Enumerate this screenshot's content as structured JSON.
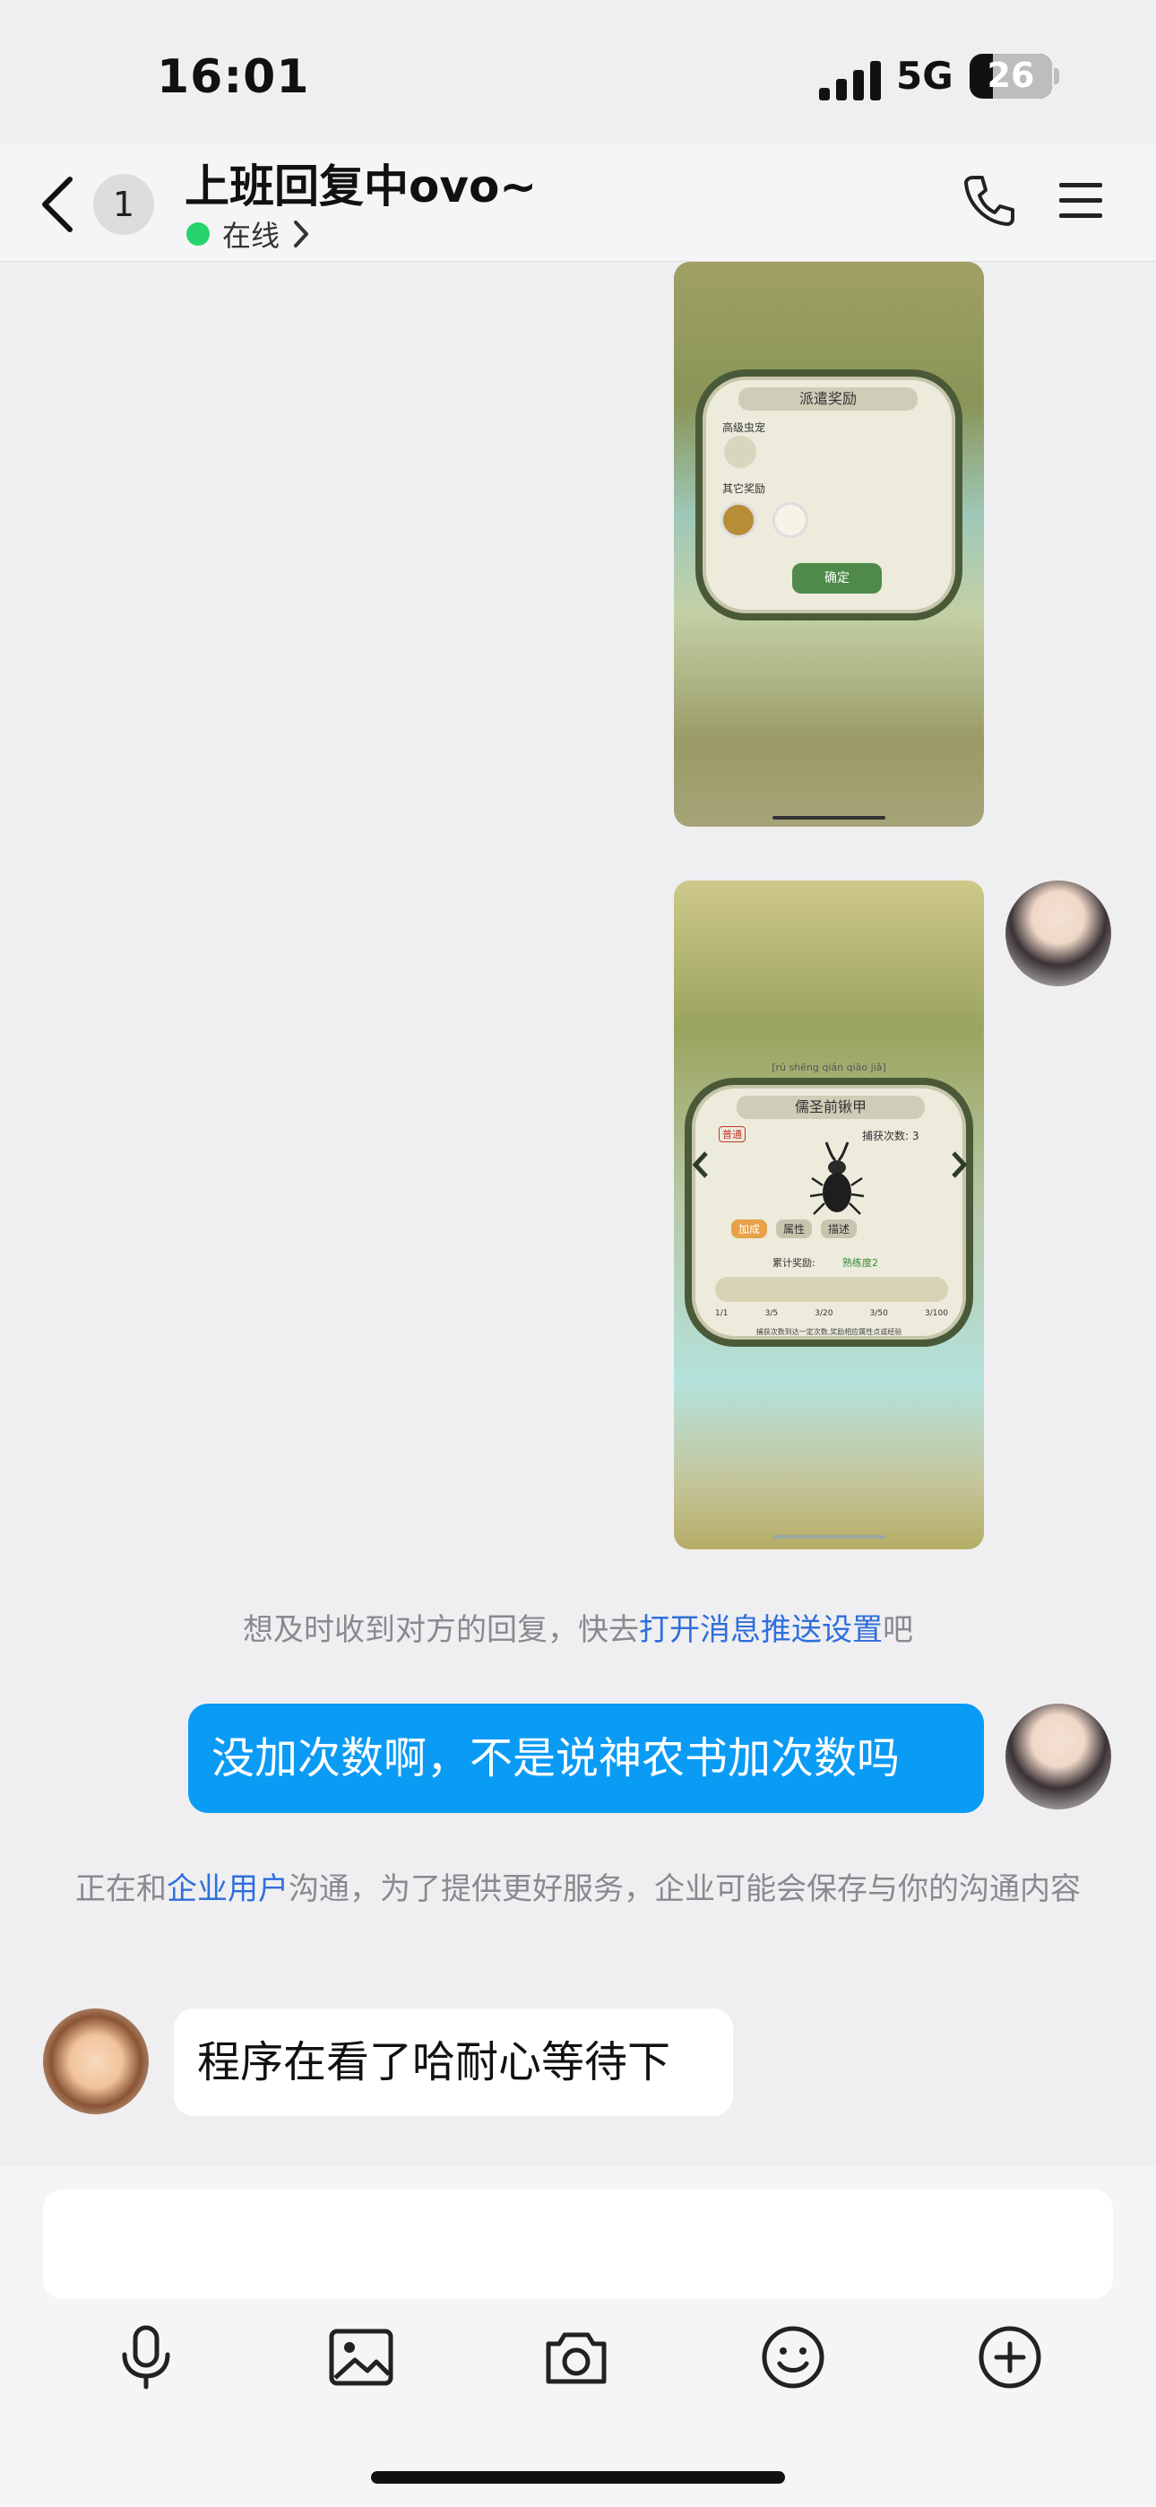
{
  "status_bar": {
    "time": "16:01",
    "network": "5G",
    "battery": "26"
  },
  "header": {
    "back_badge": "1",
    "contact_name": "上班回复中ovo~",
    "status": "在线"
  },
  "screenshot_1": {
    "panel_title": "派遣奖励",
    "label_1": "高级虫宠",
    "label_2": "其它奖励",
    "confirm": "确定"
  },
  "screenshot_2": {
    "pinyin": "[rú shēng qián qiāo jiǎ]",
    "panel_title": "儒圣前锹甲",
    "tag": "普通",
    "capture_count": "捕获次数: 3",
    "tabs": [
      "加成",
      "属性",
      "描述"
    ],
    "reward_label": "累计奖励:",
    "reward_value": "熟练度2",
    "milestones": [
      "1/1",
      "3/5",
      "3/20",
      "3/50",
      "3/100"
    ],
    "hint": "捕获次数到达一定次数,奖励相应属性点或经验"
  },
  "system_notice_1": {
    "before": "想及时收到对方的回复，快去",
    "link": "打开消息推送设置",
    "after": "吧"
  },
  "outgoing_message": "没加次数啊，不是说神农书加次数吗",
  "system_notice_2": {
    "before": "正在和",
    "link": "企业用户",
    "after": "沟通，为了提供更好服务，企业可能会保存与你的沟通内容"
  },
  "incoming_message": "程序在看了哈耐心等待下",
  "toolbar": {
    "icons": [
      "microphone-icon",
      "image-icon",
      "camera-icon",
      "emoji-icon",
      "plus-icon"
    ]
  },
  "colors": {
    "accent": "#0a9bf5",
    "link": "#2f6fdb",
    "online": "#27d36c"
  }
}
